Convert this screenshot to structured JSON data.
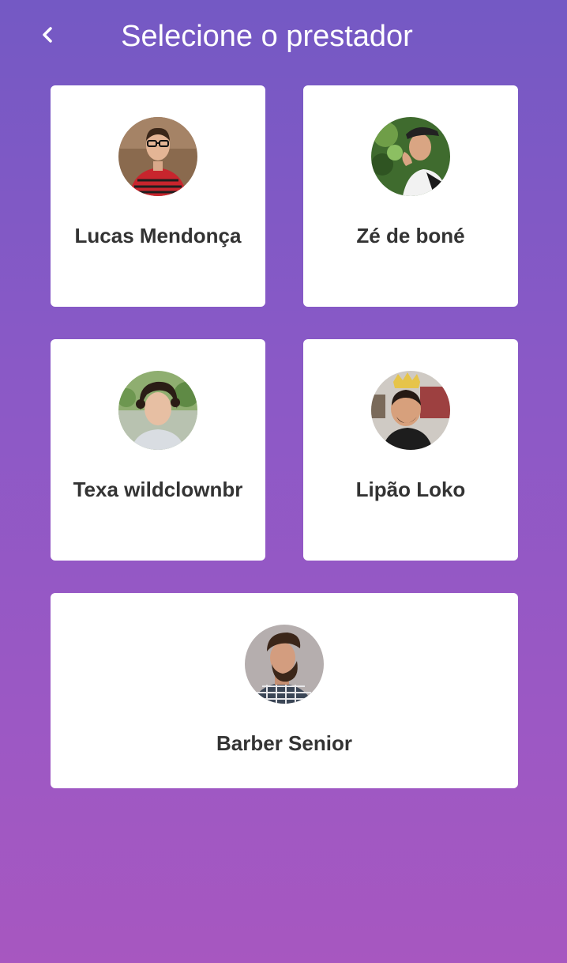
{
  "header": {
    "title": "Selecione o prestador",
    "back_icon": "chevron-left-icon"
  },
  "providers": [
    {
      "name": "Lucas Mendonça",
      "avatar": "photo"
    },
    {
      "name": "Zé de boné",
      "avatar": "photo"
    },
    {
      "name": "Texa wildclownbr",
      "avatar": "photo"
    },
    {
      "name": "Lipão Loko",
      "avatar": "photo"
    },
    {
      "name": "Barber Senior",
      "avatar": "photo"
    }
  ],
  "colors": {
    "gradient_top": "#7459c4",
    "gradient_bottom": "#a757c0",
    "card_background": "#ffffff",
    "name_text": "#333333",
    "title_text": "#ffffff"
  }
}
